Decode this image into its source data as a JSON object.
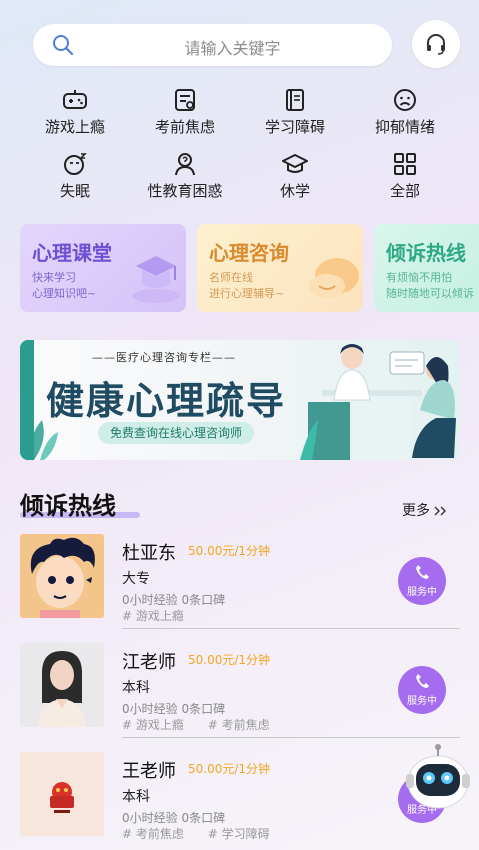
{
  "search": {
    "placeholder": "请输入关键字"
  },
  "categories": [
    {
      "label": "游戏上瘾",
      "icon": "gamepad-icon"
    },
    {
      "label": "考前焦虑",
      "icon": "exam-icon"
    },
    {
      "label": "学习障碍",
      "icon": "notebook-icon"
    },
    {
      "label": "抑郁情绪",
      "icon": "sad-face-icon"
    },
    {
      "label": "失眠",
      "icon": "sleep-icon"
    },
    {
      "label": "性教育困惑",
      "icon": "person-question-icon"
    },
    {
      "label": "休学",
      "icon": "graduation-cap-icon"
    },
    {
      "label": "全部",
      "icon": "grid-icon"
    }
  ],
  "cards": [
    {
      "title": "心理课堂",
      "line1": "快来学习",
      "line2": "心理知识吧~"
    },
    {
      "title": "心理咨询",
      "line1": "名师在线",
      "line2": "进行心理辅导~"
    },
    {
      "title": "倾诉热线",
      "line1": "有烦恼不用怕",
      "line2": "随时随地可以倾诉"
    }
  ],
  "banner": {
    "subtitle": "——医疗心理咨询专栏——",
    "title": "健康心理疏导",
    "button": "免费查询在线心理咨询师"
  },
  "section": {
    "title": "倾诉热线",
    "more": "更多"
  },
  "counselors": [
    {
      "name": "杜亚东",
      "price": "50.00元/1分钟",
      "education": "大专",
      "experience": "0小时经验  0条口碑",
      "tags": [
        "# 游戏上瘾"
      ],
      "status": "服务中"
    },
    {
      "name": "江老师",
      "price": "50.00元/1分钟",
      "education": "本科",
      "experience": "0小时经验  0条口碑",
      "tags": [
        "# 游戏上瘾",
        "# 考前焦虑"
      ],
      "status": "服务中"
    },
    {
      "name": "王老师",
      "price": "50.00元/1分钟",
      "education": "本科",
      "experience": "0小时经验  0条口碑",
      "tags": [
        "# 考前焦虑",
        "# 学习障碍"
      ],
      "status": "服务中"
    }
  ],
  "colors": {
    "accent": "#a56cf0",
    "price": "#f5a623",
    "banner_title": "#1f4b63"
  }
}
